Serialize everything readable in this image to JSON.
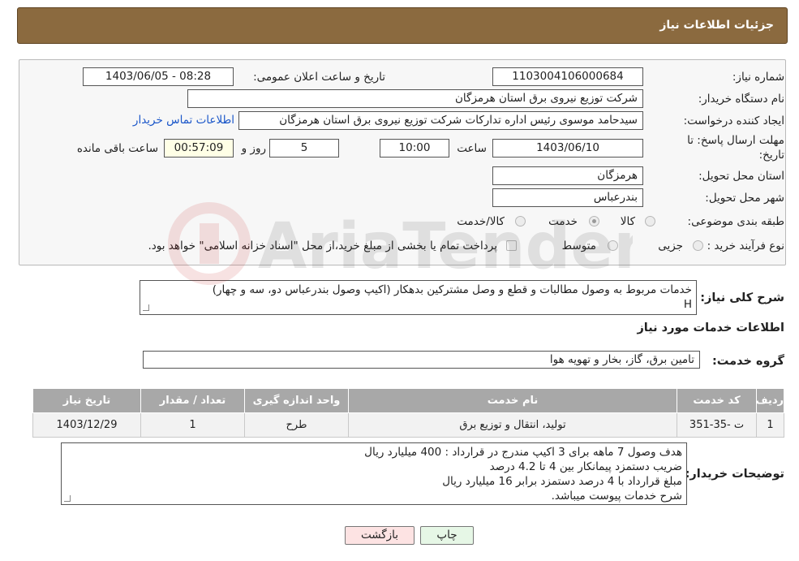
{
  "header": {
    "title": "جزئیات اطلاعات نیاز"
  },
  "form": {
    "need_number_label": "شماره نیاز:",
    "need_number": "1103004106000684",
    "announce_label": "تاریخ و ساعت اعلان عمومی:",
    "announce_value": "1403/06/05 - 08:28",
    "buyer_org_label": "نام دستگاه خریدار:",
    "buyer_org": "شرکت توزیع نیروی برق استان هرمزگان",
    "requester_label": "ایجاد کننده درخواست:",
    "requester": "سیدحامد موسوی رئیس اداره تدارکات شرکت توزیع نیروی برق استان هرمزگان",
    "contact_link": "اطلاعات تماس خریدار",
    "deadline_label_1": "مهلت ارسال پاسخ: تا",
    "deadline_label_2": "تاریخ:",
    "deadline_date": "1403/06/10",
    "time_label": "ساعت",
    "deadline_time": "10:00",
    "days_value": "5",
    "days_label": "روز و",
    "remaining_time": "00:57:09",
    "remaining_label": "ساعت باقی مانده",
    "province_label": "استان محل تحویل:",
    "province": "هرمزگان",
    "city_label": "شهر محل تحویل:",
    "city": "بندرعباس",
    "category_label": "طبقه بندی موضوعی:",
    "category_options": [
      "کالا",
      "خدمت",
      "کالا/خدمت"
    ],
    "process_label": "نوع فرآیند خرید :",
    "process_options": [
      "جزیی",
      "متوسط"
    ],
    "payment_note": "پرداخت تمام یا بخشی از مبلغ خرید،از محل \"اسناد خزانه اسلامی\" خواهد بود."
  },
  "summary": {
    "label": "شرح کلی نیاز:",
    "line1": "خدمات مربوط به وصول مطالبات و قطع و وصل مشترکین بدهکار (اکیپ وصول بندرعباس دو، سه و چهار)",
    "line2": "H"
  },
  "services_section": {
    "title": "اطلاعات خدمات مورد نیاز"
  },
  "service_group": {
    "label": "گروه خدمت:",
    "value": "تامین برق، گاز، بخار و تهویه هوا"
  },
  "table": {
    "headers": [
      "ردیف",
      "کد خدمت",
      "نام خدمت",
      "واحد اندازه گیری",
      "تعداد / مقدار",
      "تاریخ نیاز"
    ],
    "rows": [
      [
        "1",
        "ت -35-351",
        "تولید، انتقال و توزیع برق",
        "طرح",
        "1",
        "1403/12/29"
      ]
    ]
  },
  "buyer_notes": {
    "label": "توضیحات خریدار:",
    "lines": [
      "هدف وصول 7 ماهه برای 3 اکیپ مندرج در قرارداد : 400 میلیارد ریال",
      "ضریب دستمزد پیمانکار بین 4 تا 4.2 درصد",
      "مبلغ قرارداد با 4 درصد دستمزد برابر 16 میلیارد ریال",
      "شرح خدمات پیوست میباشد."
    ]
  },
  "buttons": {
    "print": "چاپ",
    "back": "بازگشت"
  },
  "watermark": {
    "text": "AriaTender.neT"
  },
  "colors": {
    "header_bg": "#8b6a3f",
    "table_header_bg": "#a8a8a8",
    "back_button_bg": "#fde3e3",
    "print_button_bg": "#e6f7e6",
    "link": "#1a56c9"
  }
}
